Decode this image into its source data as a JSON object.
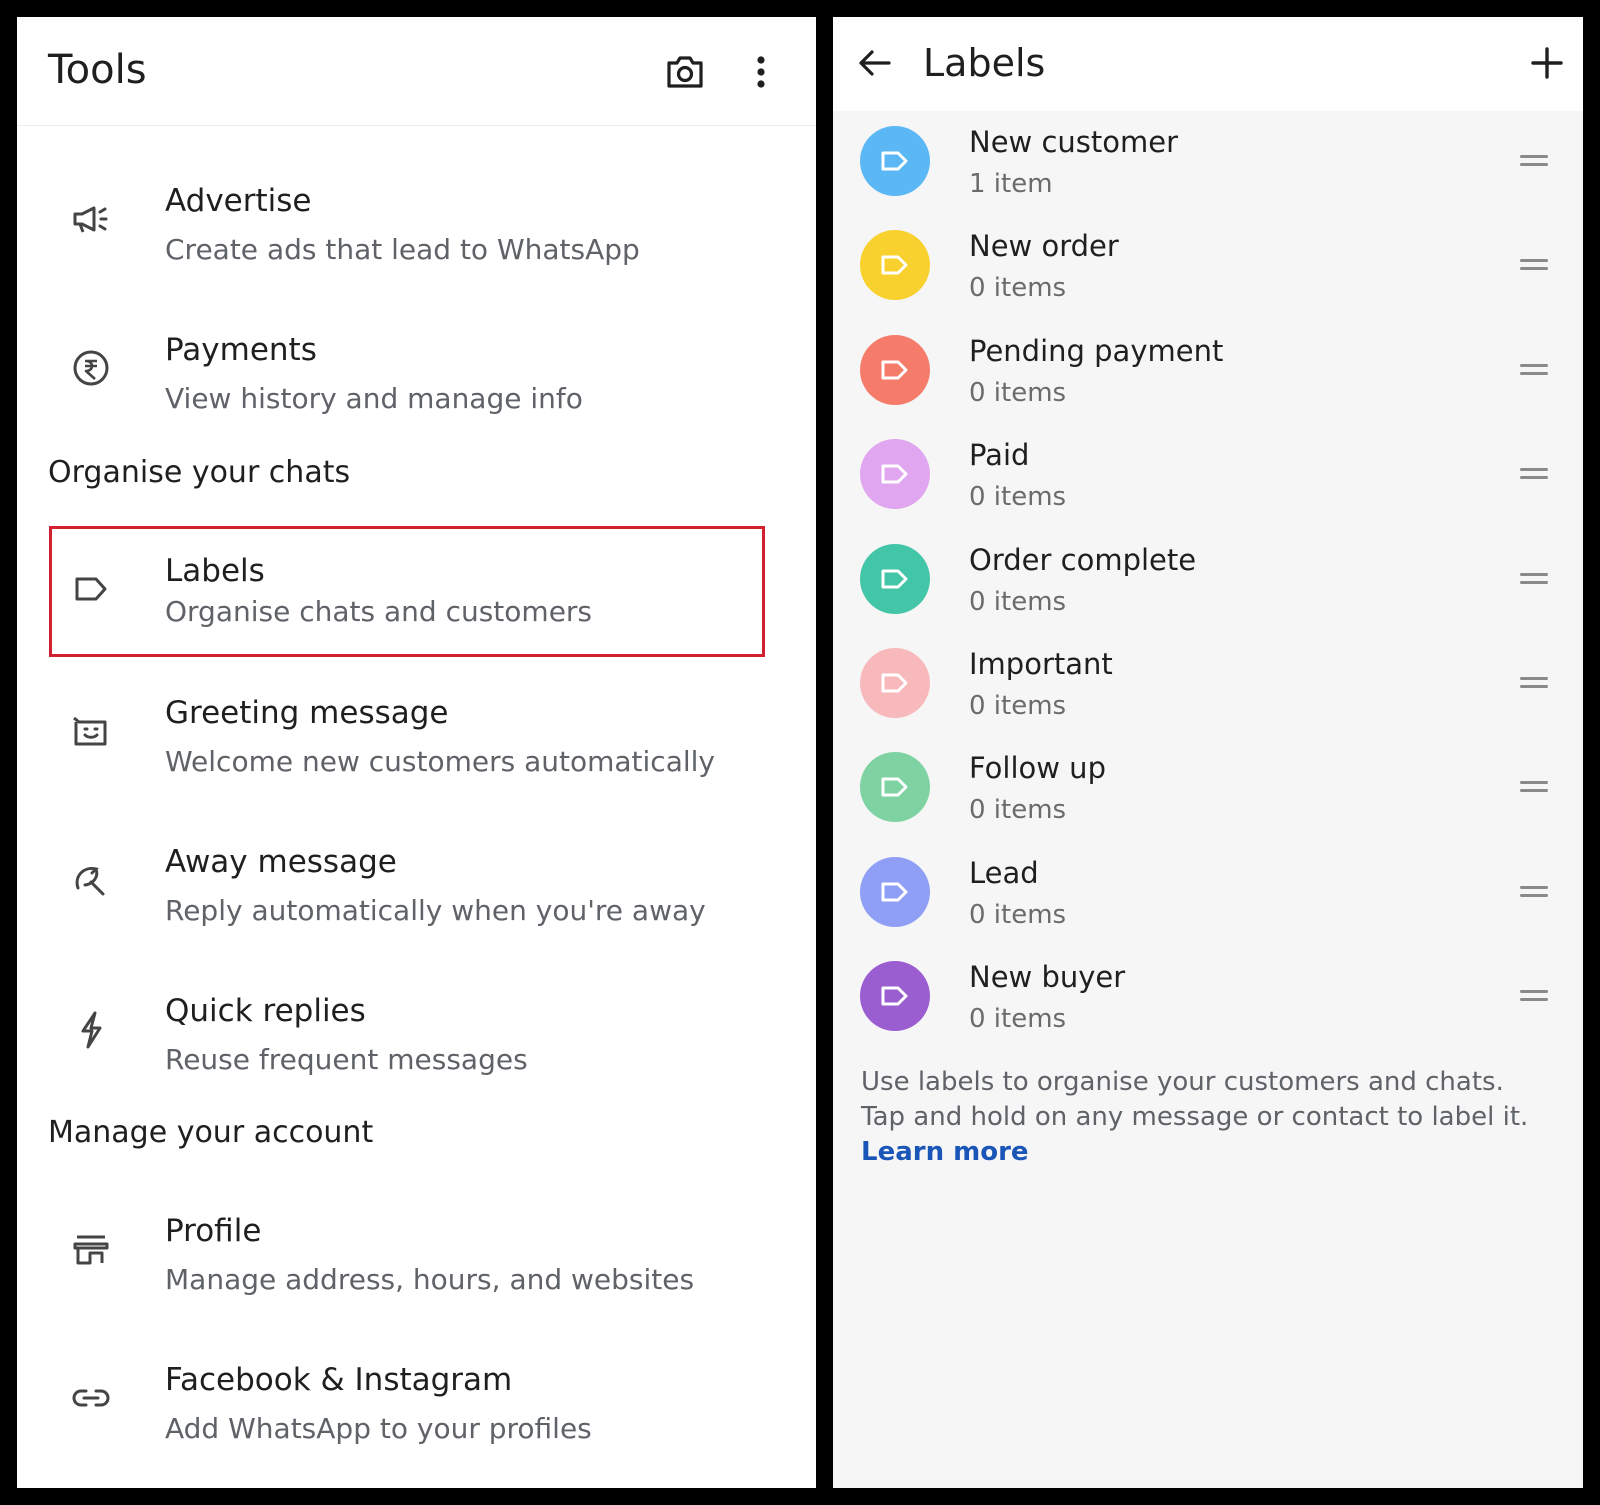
{
  "tools_panel": {
    "title": "Tools",
    "header_icons": [
      "camera-icon",
      "more-vert-icon"
    ],
    "items_top": [
      {
        "title": "Advertise",
        "subtitle": "Create ads that lead to WhatsApp",
        "icon": "megaphone-icon"
      },
      {
        "title": "Payments",
        "subtitle": "View history and manage info",
        "icon": "rupee-icon"
      }
    ],
    "section_organise": "Organise your chats",
    "items_organise": [
      {
        "title": "Labels",
        "subtitle": "Organise chats and customers",
        "icon": "label-icon"
      },
      {
        "title": "Greeting message",
        "subtitle": "Welcome new customers automatically",
        "icon": "greeting-icon"
      },
      {
        "title": "Away message",
        "subtitle": "Reply automatically when you're away",
        "icon": "away-icon"
      },
      {
        "title": "Quick replies",
        "subtitle": "Reuse frequent messages",
        "icon": "lightning-icon"
      }
    ],
    "section_manage": "Manage your account",
    "items_manage": [
      {
        "title": "Profile",
        "subtitle": "Manage address, hours, and websites",
        "icon": "store-icon"
      },
      {
        "title": "Facebook & Instagram",
        "subtitle": "Add WhatsApp to your profiles",
        "icon": "link-icon"
      }
    ],
    "highlight_color": "#d32030"
  },
  "labels_panel": {
    "title": "Labels",
    "header_icons": [
      "back-arrow-icon",
      "add-icon"
    ],
    "labels": [
      {
        "name": "New customer",
        "count": "1 item",
        "color": "#5bb8f5"
      },
      {
        "name": "New order",
        "count": "0 items",
        "color": "#f8d12f"
      },
      {
        "name": "Pending payment",
        "count": "0 items",
        "color": "#f57c6b"
      },
      {
        "name": "Paid",
        "count": "0 items",
        "color": "#e0a6ef"
      },
      {
        "name": "Order complete",
        "count": "0 items",
        "color": "#43c6a8"
      },
      {
        "name": "Important",
        "count": "0 items",
        "color": "#f8b9bd"
      },
      {
        "name": "Follow up",
        "count": "0 items",
        "color": "#7fd3a3"
      },
      {
        "name": "Lead",
        "count": "0 items",
        "color": "#8f9ff5"
      },
      {
        "name": "New buyer",
        "count": "0 items",
        "color": "#9b5ed1"
      }
    ],
    "info_line1": "Use labels to organise your customers and chats.",
    "info_line2": "Tap and hold on any message or contact to label it.",
    "learn_more": "Learn more",
    "link_color": "#1a56b8"
  }
}
